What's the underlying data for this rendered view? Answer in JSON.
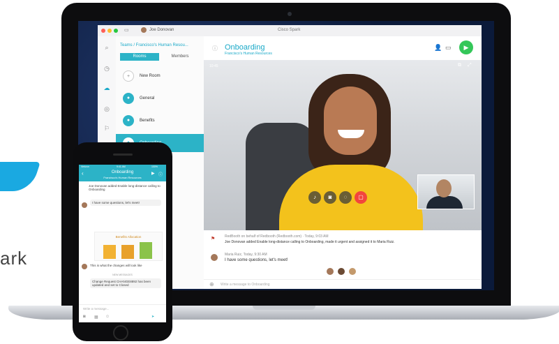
{
  "brand": {
    "fragment_text": "ark",
    "accent": "#1aa9e1"
  },
  "window": {
    "title": "Cisco Spark",
    "user": "Joe Donovan"
  },
  "sidebar": {
    "breadcrumb": "Teams / Francisco's Human Resou...",
    "tabs": [
      {
        "label": "Rooms"
      },
      {
        "label": "Members"
      }
    ],
    "rooms": [
      {
        "label": "New Room"
      },
      {
        "label": "General"
      },
      {
        "label": "Benefits"
      },
      {
        "label": "Onboarding"
      }
    ]
  },
  "room": {
    "title": "Onboarding",
    "subtitle": "Francisco's Human Resources",
    "timer": "10:45"
  },
  "messages": [
    {
      "meta": "RedBooth on behalf of Redbooth (Redbooth.com) · Today, 9:03 AM",
      "text": "Joe Donovan added Enable long-distance calling to Onboarding, made it urgent and assigned it to Maria Ruiz."
    },
    {
      "meta": "Maria Ruiz, Today, 9:30 AM",
      "text": "I have some questions, let's meet!"
    }
  ],
  "compose": {
    "placeholder": "Write a message to Onboarding"
  },
  "phone": {
    "status_left": "Verizon",
    "status_time": "9:41 AM",
    "status_right": "100%",
    "title": "Onboarding",
    "subtitle": "Francisco's Human Resources",
    "msg1": "Joe Donovan added Enable long-distance calling to Onboarding",
    "msg2": "I have some questions, let's meet!",
    "image_label": "Benefits Allocation",
    "msg3": "This is what the changes will look like",
    "divider": "NEW MESSAGES",
    "msg4": "Change Request CHANGE8892 has been updated and set to Closed",
    "compose": "Write a message..."
  }
}
